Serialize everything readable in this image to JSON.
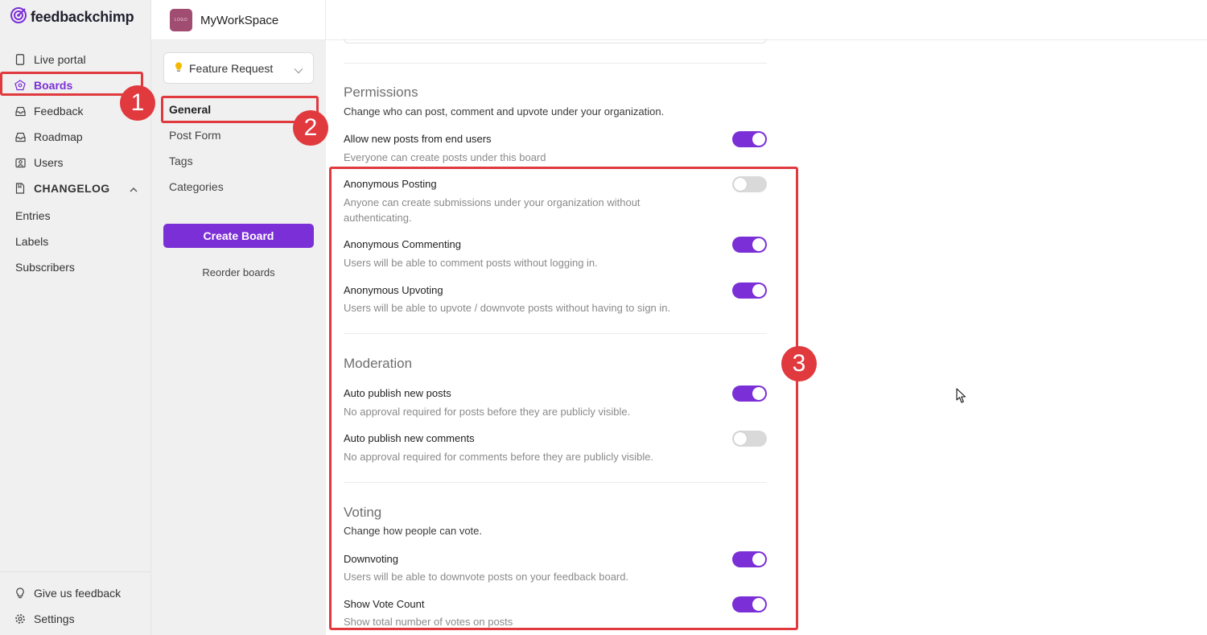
{
  "brand": {
    "name": "feedbackchimp"
  },
  "workspace": {
    "name": "MyWorkSpace",
    "logo_text": "LOGO"
  },
  "sidebar": {
    "items": [
      {
        "label": "Live portal",
        "icon": "phone-icon"
      },
      {
        "label": "Boards",
        "icon": "boards-icon",
        "active": true
      },
      {
        "label": "Feedback",
        "icon": "inbox-icon"
      },
      {
        "label": "Roadmap",
        "icon": "inbox-icon"
      },
      {
        "label": "Users",
        "icon": "users-icon"
      },
      {
        "label": "CHANGELOG",
        "icon": "document-icon"
      }
    ],
    "changelog_items": [
      {
        "label": "Entries"
      },
      {
        "label": "Labels"
      },
      {
        "label": "Subscribers"
      }
    ],
    "bottom_items": [
      {
        "label": "Give us feedback",
        "icon": "lightbulb-icon"
      },
      {
        "label": "Settings",
        "icon": "gear-icon"
      }
    ]
  },
  "board_panel": {
    "selected_board": "Feature Request",
    "menu": [
      {
        "label": "General",
        "active": true
      },
      {
        "label": "Post Form"
      },
      {
        "label": "Tags"
      },
      {
        "label": "Categories"
      }
    ],
    "create_label": "Create Board",
    "reorder_label": "Reorder boards"
  },
  "permissions": {
    "title": "Permissions",
    "desc": "Change who can post, comment and upvote under your organization.",
    "settings": [
      {
        "label": "Allow new posts from end users",
        "desc": "Everyone can create posts under this board",
        "enabled": true
      },
      {
        "label": "Anonymous Posting",
        "desc": "Anyone can create submissions under your organization without authenticating.",
        "enabled": false
      },
      {
        "label": "Anonymous Commenting",
        "desc": "Users will be able to comment posts without logging in.",
        "enabled": true
      },
      {
        "label": "Anonymous Upvoting",
        "desc": "Users will be able to upvote / downvote posts without having to sign in.",
        "enabled": true
      }
    ]
  },
  "moderation": {
    "title": "Moderation",
    "settings": [
      {
        "label": "Auto publish new posts",
        "desc": "No approval required for posts before they are publicly visible.",
        "enabled": true
      },
      {
        "label": "Auto publish new comments",
        "desc": "No approval required for comments before they are publicly visible.",
        "enabled": false
      }
    ]
  },
  "voting": {
    "title": "Voting",
    "desc": "Change how people can vote.",
    "settings": [
      {
        "label": "Downvoting",
        "desc": "Users will be able to downvote posts on your feedback board.",
        "enabled": true
      },
      {
        "label": "Show Vote Count",
        "desc": "Show total number of votes on posts",
        "enabled": true
      }
    ]
  },
  "annotations": {
    "badge_1": "1",
    "badge_2": "2",
    "badge_3": "3",
    "color": "#e0393e"
  },
  "colors": {
    "accent": "#7b2fd6",
    "toggle_off": "#d9d9d9",
    "sidebar_bg": "#f0f0f0"
  }
}
